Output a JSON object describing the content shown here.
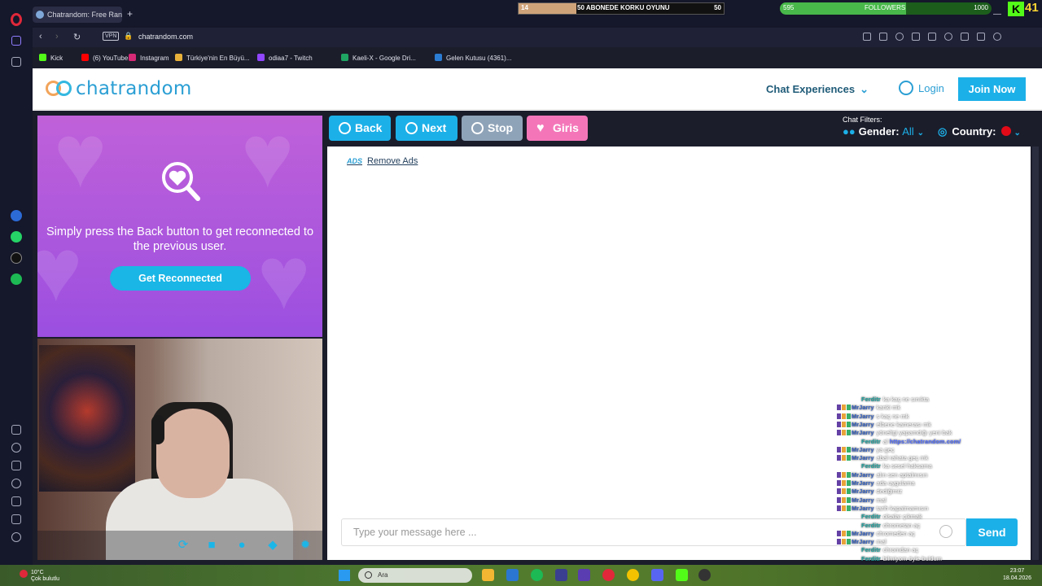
{
  "browser": {
    "tab_title": "Chatrandom: Free Ran",
    "new_tab": "+",
    "url": "chatrandom.com",
    "vpn": "VPN",
    "bookmarks": [
      {
        "label": "Kick",
        "color": "#53fc18"
      },
      {
        "label": "(6) YouTube",
        "color": "#ff0000"
      },
      {
        "label": "Instagram",
        "color": "#d62976"
      },
      {
        "label": "Türkiye'nin En Büyü...",
        "color": "#e8b13a"
      },
      {
        "label": "odiaa7 - Twitch",
        "color": "#9146ff"
      },
      {
        "label": "Kaeli-X - Google Dri...",
        "color": "#1fa463"
      },
      {
        "label": "Gelen Kutusu (4361)...",
        "color": "#2b7cd3"
      }
    ]
  },
  "stream_overlay": {
    "goal_start": "14",
    "goal_title": "50 ABONEDE KORKU OYUNU",
    "goal_end": "50",
    "goal_progress": 0.28,
    "followers_start": "595",
    "followers_label": "FOLLOWERS",
    "followers_end": "1000",
    "followers_progress": 0.595,
    "kick_viewers": "41",
    "chat": [
      {
        "user": "Ferditr",
        "msg": "ka kaç ne sınıkta",
        "type": "mod"
      },
      {
        "user": "MrJarry",
        "msg": "kanki mk",
        "type": "sub"
      },
      {
        "user": "MrJarry",
        "msg": "s kaç ne mk",
        "type": "sub"
      },
      {
        "user": "MrJarry",
        "msg": "elbene kamerası mk",
        "type": "sub"
      },
      {
        "user": "MrJarry",
        "msg": "yöneltgi yapamdığı yeni bak",
        "type": "sub"
      },
      {
        "user": "Ferditr",
        "msg": "al ",
        "link": "https://chatrandom.com/",
        "type": "mod"
      },
      {
        "user": "MrJarry",
        "msg": "ya geç",
        "type": "sub"
      },
      {
        "user": "MrJarry",
        "msg": "abal rahata geç mk",
        "type": "sub"
      },
      {
        "user": "Ferditr",
        "msg": "ka sesel haksama",
        "type": "mod"
      },
      {
        "user": "MrJarry",
        "msg": "alın sen aptalmısın",
        "type": "sub"
      },
      {
        "user": "MrJarry",
        "msg": "ada uygulama",
        "type": "sub"
      },
      {
        "user": "MrJarry",
        "msg": "dediğimiz",
        "type": "sub"
      },
      {
        "user": "MrJarry",
        "msg": "mal",
        "type": "sub"
      },
      {
        "user": "MrJarry",
        "msg": "tarih kapatmamısın",
        "type": "sub"
      },
      {
        "user": "Ferditr",
        "msg": "olsalar çıkmak",
        "type": "mod"
      },
      {
        "user": "Ferditr",
        "msg": "chrometan aç",
        "type": "mod"
      },
      {
        "user": "MrJarry",
        "msg": "chromeden aç",
        "type": "sub"
      },
      {
        "user": "MrJarry",
        "msg": "mal",
        "type": "sub"
      },
      {
        "user": "Ferditr",
        "msg": "chromdan aç",
        "type": "mod"
      },
      {
        "user": "Ferditr",
        "msg": "bilmiyom öyle buldum",
        "type": "mod"
      }
    ]
  },
  "site": {
    "logo_text": "chatrandom",
    "nav_experiences": "Chat Experiences",
    "login": "Login",
    "join": "Join Now"
  },
  "promo": {
    "text": "Simply press the Back button to get reconnected to the previous user.",
    "button": "Get Reconnected"
  },
  "controls": {
    "back": "Back",
    "next": "Next",
    "stop": "Stop",
    "girls": "Giris"
  },
  "filters": {
    "label": "Chat Filters:",
    "gender_label": "Gender:",
    "gender_value": "All",
    "country_label": "Country:"
  },
  "chat": {
    "remove_ads": "Remove Ads",
    "ads_icon": "ADS",
    "placeholder": "Type your message here ...",
    "send": "Send"
  },
  "taskbar": {
    "weather_temp": "10°C",
    "weather_desc": "Çok bulutlu",
    "search": "Ara",
    "time": "23:07",
    "date": "18.04.2026"
  },
  "colors": {
    "accent": "#1cb0e8",
    "stop": "#8fa3b8",
    "girls": "#f476b9",
    "promo_top": "#c061d9",
    "promo_bottom": "#9b4fe0"
  }
}
